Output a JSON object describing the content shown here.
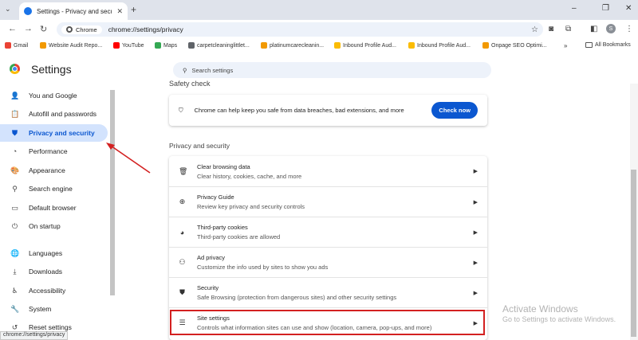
{
  "tab": {
    "title": "Settings - Privacy and security"
  },
  "omnibox": {
    "chip": "Chrome",
    "url": "chrome://settings/privacy"
  },
  "avatar": "S",
  "bookmarks": [
    {
      "label": "Gmail",
      "color": "#ea4335"
    },
    {
      "label": "Website Audit Repo...",
      "color": "#f29900"
    },
    {
      "label": "YouTube",
      "color": "#ff0000"
    },
    {
      "label": "Maps",
      "color": "#34a853"
    },
    {
      "label": "carpetcleaninglittlet...",
      "color": "#5f6368"
    },
    {
      "label": "platinumcarecleanin...",
      "color": "#f29900"
    },
    {
      "label": "Inbound Profile Aud...",
      "color": "#fbbc04"
    },
    {
      "label": "Inbound Profile Aud...",
      "color": "#fbbc04"
    },
    {
      "label": "Onpage SEO Optimi...",
      "color": "#f29900"
    }
  ],
  "bookmarks_more": "»",
  "bookmarks_all": "All Bookmarks",
  "header": {
    "title": "Settings",
    "search_placeholder": "Search settings"
  },
  "sidebar": {
    "items": [
      {
        "label": "You and Google",
        "icon": "person-icon"
      },
      {
        "label": "Autofill and passwords",
        "icon": "clipboard-icon"
      },
      {
        "label": "Privacy and security",
        "icon": "shield-icon"
      },
      {
        "label": "Performance",
        "icon": "speedometer-icon"
      },
      {
        "label": "Appearance",
        "icon": "palette-icon"
      },
      {
        "label": "Search engine",
        "icon": "search-icon"
      },
      {
        "label": "Default browser",
        "icon": "browser-icon"
      },
      {
        "label": "On startup",
        "icon": "power-icon"
      },
      {
        "label": "Languages",
        "icon": "globe-icon"
      },
      {
        "label": "Downloads",
        "icon": "download-icon"
      },
      {
        "label": "Accessibility",
        "icon": "accessibility-icon"
      },
      {
        "label": "System",
        "icon": "wrench-icon"
      },
      {
        "label": "Reset settings",
        "icon": "reset-icon"
      }
    ]
  },
  "status_url": "chrome://settings/privacy",
  "safety": {
    "label": "Safety check",
    "text": "Chrome can help keep you safe from data breaches, bad extensions, and more",
    "button": "Check now"
  },
  "privacy": {
    "label": "Privacy and security",
    "rows": [
      {
        "title": "Clear browsing data",
        "subtitle": "Clear history, cookies, cache, and more",
        "icon": "trash-icon"
      },
      {
        "title": "Privacy Guide",
        "subtitle": "Review key privacy and security controls",
        "icon": "compass-icon"
      },
      {
        "title": "Third-party cookies",
        "subtitle": "Third-party cookies are allowed",
        "icon": "cookie-icon"
      },
      {
        "title": "Ad privacy",
        "subtitle": "Customize the info used by sites to show you ads",
        "icon": "ad-privacy-icon"
      },
      {
        "title": "Security",
        "subtitle": "Safe Browsing (protection from dangerous sites) and other security settings",
        "icon": "shield-icon"
      },
      {
        "title": "Site settings",
        "subtitle": "Controls what information sites can use and show (location, camera, pop-ups, and more)",
        "icon": "sliders-icon"
      }
    ]
  },
  "watermark": {
    "line1": "Activate Windows",
    "line2": "Go to Settings to activate Windows."
  },
  "colors": {
    "accent": "#0b57d0",
    "active_bg": "#d3e3fd",
    "annotation": "#d32020"
  }
}
